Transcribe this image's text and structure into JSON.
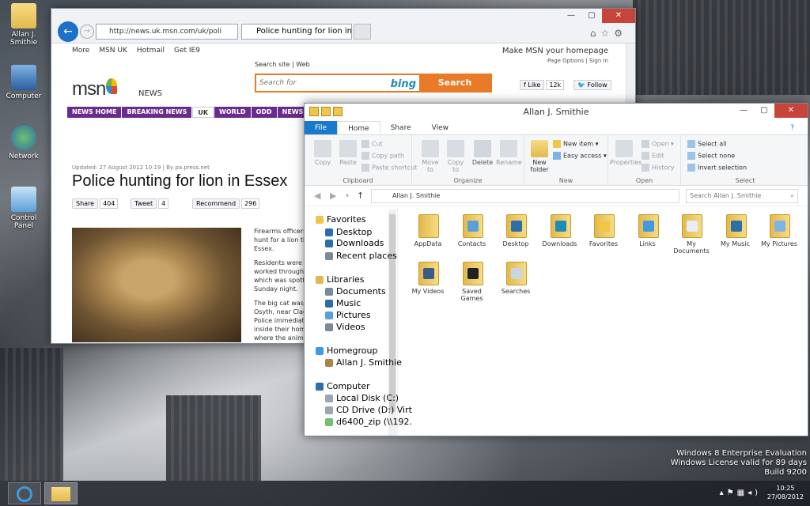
{
  "desktop": {
    "icons": [
      {
        "label": "Allan J.\nSmithie",
        "icon": "user-folder-icon"
      },
      {
        "label": "Computer",
        "icon": "computer-icon"
      },
      {
        "label": "Network",
        "icon": "network-icon"
      },
      {
        "label": "Control\nPanel",
        "icon": "control-panel-icon"
      }
    ],
    "watermark": [
      "Windows 8 Enterprise Evaluation",
      "Windows License valid for 89 days",
      "Build 9200"
    ]
  },
  "ie": {
    "address": "http://news.uk.msn.com/uk/poli",
    "tab_title": "Police hunting for lion in Ess...",
    "nav": [
      "More",
      "MSN UK",
      "Hotmail",
      "Get IE9"
    ],
    "homepage_link": "Make MSN your homepage",
    "page_options": "Page Options",
    "sign_in": "Sign In",
    "logo": "msn",
    "news": "NEWS",
    "search_site": "Search site",
    "web": "Web",
    "search_placeholder": "Search for",
    "bing": "bing",
    "search_button": "Search",
    "fb_like": "Like",
    "fb_like_count": "12k",
    "follow": "Follow",
    "menu": [
      "NEWS HOME",
      "BREAKING NEWS",
      "UK",
      "WORLD",
      "ODD",
      "NEWSB"
    ],
    "updated": "Updated: 27 August 2012 10:19 | By pa.press.net",
    "headline": "Police hunting for lion in Essex",
    "share": "Share",
    "share_count": "404",
    "tweet": "Tweet",
    "tweet_count": "4",
    "recommend": "Recommend",
    "recommend_count": "296",
    "article": [
      "Firearms officers",
      "hunt for a lion tha",
      "Essex.",
      "Residents were to",
      "worked throughou",
      "which was spotte",
      "Sunday night.",
      "The big cat was s",
      "Osyth, near Clac",
      "Police immediate",
      "inside their home",
      "where the animal"
    ]
  },
  "explorer": {
    "title": "Allan J. Smithie",
    "tabs": [
      "File",
      "Home",
      "Share",
      "View"
    ],
    "ribbon": {
      "copy": "Copy",
      "paste": "Paste",
      "cut": "Cut",
      "copy_path": "Copy path",
      "paste_shortcut": "Paste shortcut",
      "clipboard": "Clipboard",
      "move_to": "Move\nto",
      "copy_to": "Copy\nto",
      "delete": "Delete",
      "rename": "Rename",
      "organize": "Organize",
      "new_folder": "New\nfolder",
      "new_item": "New item",
      "easy_access": "Easy access",
      "new": "New",
      "properties": "Properties",
      "open": "Open",
      "edit": "Edit",
      "history": "History",
      "open_grp": "Open",
      "select_all": "Select all",
      "select_none": "Select none",
      "invert_selection": "Invert selection",
      "select": "Select"
    },
    "breadcrumb": "Allan J. Smithie",
    "search_placeholder": "Search Allan J. Smithie",
    "nav": [
      {
        "label": "Favorites",
        "icon": "star-icon"
      },
      {
        "label": "Desktop",
        "icon": "desktop-icon"
      },
      {
        "label": "Downloads",
        "icon": "downloads-icon"
      },
      {
        "label": "Recent places",
        "icon": "recent-places-icon"
      },
      {
        "label": "Libraries",
        "icon": "libraries-icon"
      },
      {
        "label": "Documents",
        "icon": "documents-icon"
      },
      {
        "label": "Music",
        "icon": "music-icon"
      },
      {
        "label": "Pictures",
        "icon": "pictures-icon"
      },
      {
        "label": "Videos",
        "icon": "videos-icon"
      },
      {
        "label": "Homegroup",
        "icon": "homegroup-icon"
      },
      {
        "label": "Allan J. Smithie",
        "icon": "user-icon"
      },
      {
        "label": "Computer",
        "icon": "computer-icon"
      },
      {
        "label": "Local Disk (C:)",
        "icon": "disk-icon"
      },
      {
        "label": "CD Drive (D:) Virt",
        "icon": "cd-drive-icon"
      },
      {
        "label": "d6400_zip (\\\\192.",
        "icon": "network-drive-icon"
      }
    ],
    "folders": [
      {
        "label": "AppData"
      },
      {
        "label": "Contacts"
      },
      {
        "label": "Desktop"
      },
      {
        "label": "Downloads"
      },
      {
        "label": "Favorites"
      },
      {
        "label": "Links"
      },
      {
        "label": "My\nDocuments"
      },
      {
        "label": "My Music"
      },
      {
        "label": "My Pictures"
      },
      {
        "label": "My Videos"
      },
      {
        "label": "Saved\nGames"
      },
      {
        "label": "Searches"
      }
    ]
  },
  "taskbar": {
    "time": "10:25",
    "date": "27/08/2012"
  },
  "colors": {
    "accent": "#1979ca",
    "msn_purple": "#6a2c8c",
    "bing_orange": "#e97a27"
  }
}
